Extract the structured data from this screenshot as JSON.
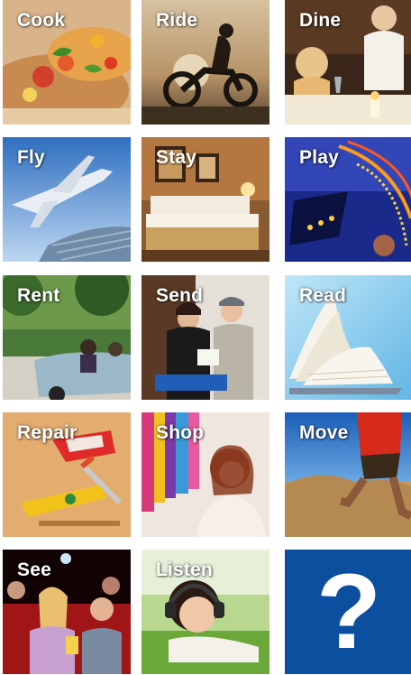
{
  "tiles": [
    {
      "label": "Cook",
      "icon": "food-plate-photo"
    },
    {
      "label": "Ride",
      "icon": "motorcycle-photo"
    },
    {
      "label": "Dine",
      "icon": "restaurant-photo"
    },
    {
      "label": "Fly",
      "icon": "airplane-photo"
    },
    {
      "label": "Stay",
      "icon": "hotel-room-photo"
    },
    {
      "label": "Play",
      "icon": "carnival-ride-photo"
    },
    {
      "label": "Rent",
      "icon": "convertible-car-photo"
    },
    {
      "label": "Send",
      "icon": "courier-delivery-photo"
    },
    {
      "label": "Read",
      "icon": "open-book-photo"
    },
    {
      "label": "Repair",
      "icon": "tools-photo"
    },
    {
      "label": "Shop",
      "icon": "clothing-store-photo"
    },
    {
      "label": "Move",
      "icon": "runner-photo"
    },
    {
      "label": "See",
      "icon": "cinema-audience-photo"
    },
    {
      "label": "Listen",
      "icon": "headphones-girl-photo"
    }
  ],
  "help_tile": {
    "symbol": "?",
    "background": "#0b4f9e"
  }
}
